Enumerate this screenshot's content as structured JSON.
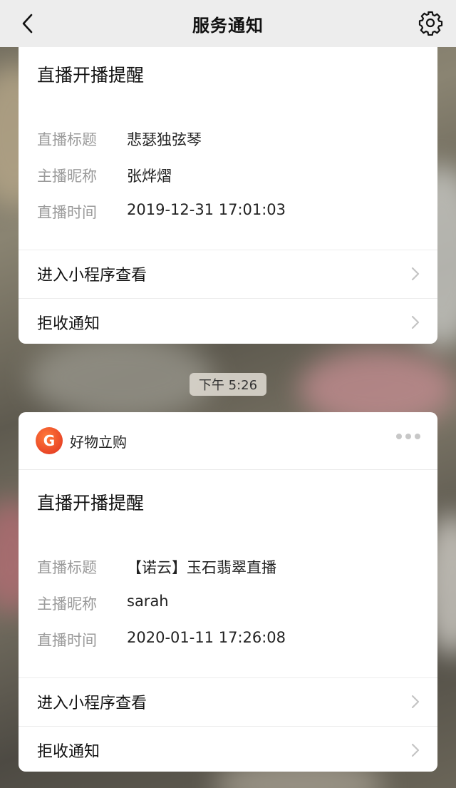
{
  "navbar": {
    "title": "服务通知",
    "back_icon": "chevron-left-icon",
    "settings_icon": "gear-icon"
  },
  "messages": [
    {
      "title": "直播开播提醒",
      "fields": [
        {
          "label": "直播标题",
          "value": "悲瑟独弦琴"
        },
        {
          "label": "主播昵称",
          "value": "张烨熠"
        },
        {
          "label": "直播时间",
          "value": "2019-12-31 17:01:03"
        }
      ],
      "actions": [
        {
          "label": "进入小程序查看"
        },
        {
          "label": "拒收通知"
        }
      ]
    },
    {
      "app_name": "好物立购",
      "app_logo_letter": "G",
      "title": "直播开播提醒",
      "fields": [
        {
          "label": "直播标题",
          "value": "【诺云】玉石翡翠直播"
        },
        {
          "label": "主播昵称",
          "value": "sarah"
        },
        {
          "label": "直播时间",
          "value": "2020-01-11 17:26:08"
        }
      ],
      "actions": [
        {
          "label": "进入小程序查看"
        },
        {
          "label": "拒收通知"
        }
      ]
    }
  ],
  "timestamp_divider": "下午 5:26",
  "colors": {
    "navbar_bg": "#ededed",
    "card_bg": "#ffffff",
    "label_gray": "#9a9a9a",
    "logo_orange": "#e0301e"
  }
}
